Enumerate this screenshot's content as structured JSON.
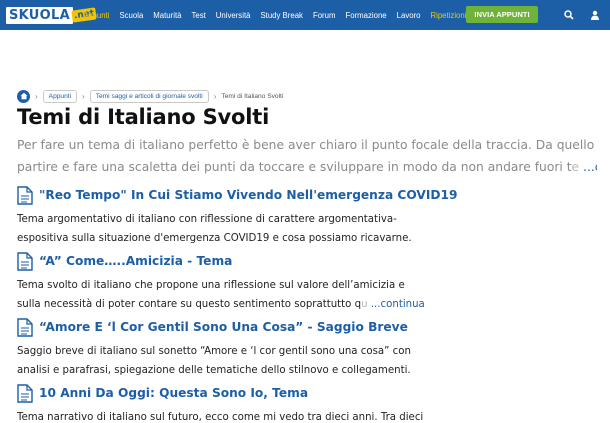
{
  "header": {
    "logo_main": "SKUOLA",
    "logo_net": ".net",
    "nav": [
      "Appunti",
      "Scuola",
      "Maturità",
      "Test",
      "Università",
      "Study Break",
      "Forum",
      "Formazione",
      "Lavoro",
      "Ripetizioni"
    ],
    "cta": "INVIA APPUNTI",
    "icons": [
      "search-icon",
      "user-icon"
    ]
  },
  "breadcrumb": {
    "items": [
      "Appunti",
      "Temi saggi e articoli di giornale svolti"
    ],
    "current": "Temi di Italiano Svolti"
  },
  "page": {
    "title": "Temi di Italiano Svolti",
    "intro_line1": "Per fare un tema di italiano perfetto è bene aver chiaro il punto focale della traccia. Da quello si deve",
    "intro_line2": "partire e fare una scaletta dei punti da toccare e sviluppare in modo da non andare fuori t",
    "intro_fade": "e",
    "intro_more": "...continua"
  },
  "articles": [
    {
      "title": "\"Reo Tempo\" In Cui Stiamo Vivendo Nell'emergenza COVID19",
      "line1": "Tema argomentativo di italiano con riflessione di carattere argomentativa-",
      "line2": "espositiva sulla situazione d'emergenza COVID19 e cosa possiamo ricavarne.",
      "more": ""
    },
    {
      "title": "“A” Come…..Amicizia - Tema",
      "line1": "Tema svolto di italiano che propone una riflessione sul valore dell’amicizia e",
      "line2": "sulla necessità di poter contare su questo sentimento soprattutto q",
      "fade": "u",
      "more": "...continua"
    },
    {
      "title": "“Amore E ‘l Cor Gentil Sono Una Cosa” - Saggio Breve",
      "line1": "Saggio breve di italiano sul sonetto “Amore e ‘l cor gentil sono una cosa” con",
      "line2": "analisi e parafrasi, spiegazione delle tematiche dello stilnovo e collegamenti.",
      "more": ""
    },
    {
      "title": "10 Anni Da Oggi: Questa Sono Io, Tema",
      "line1": "Tema narrativo di italiano sul futuro, ecco come mi vedo tra dieci anni. Tra dieci",
      "line2": "",
      "more": ""
    }
  ],
  "colors": {
    "brand": "#1d5fa7",
    "accent": "#f5c400",
    "cta": "#6fb33a"
  }
}
